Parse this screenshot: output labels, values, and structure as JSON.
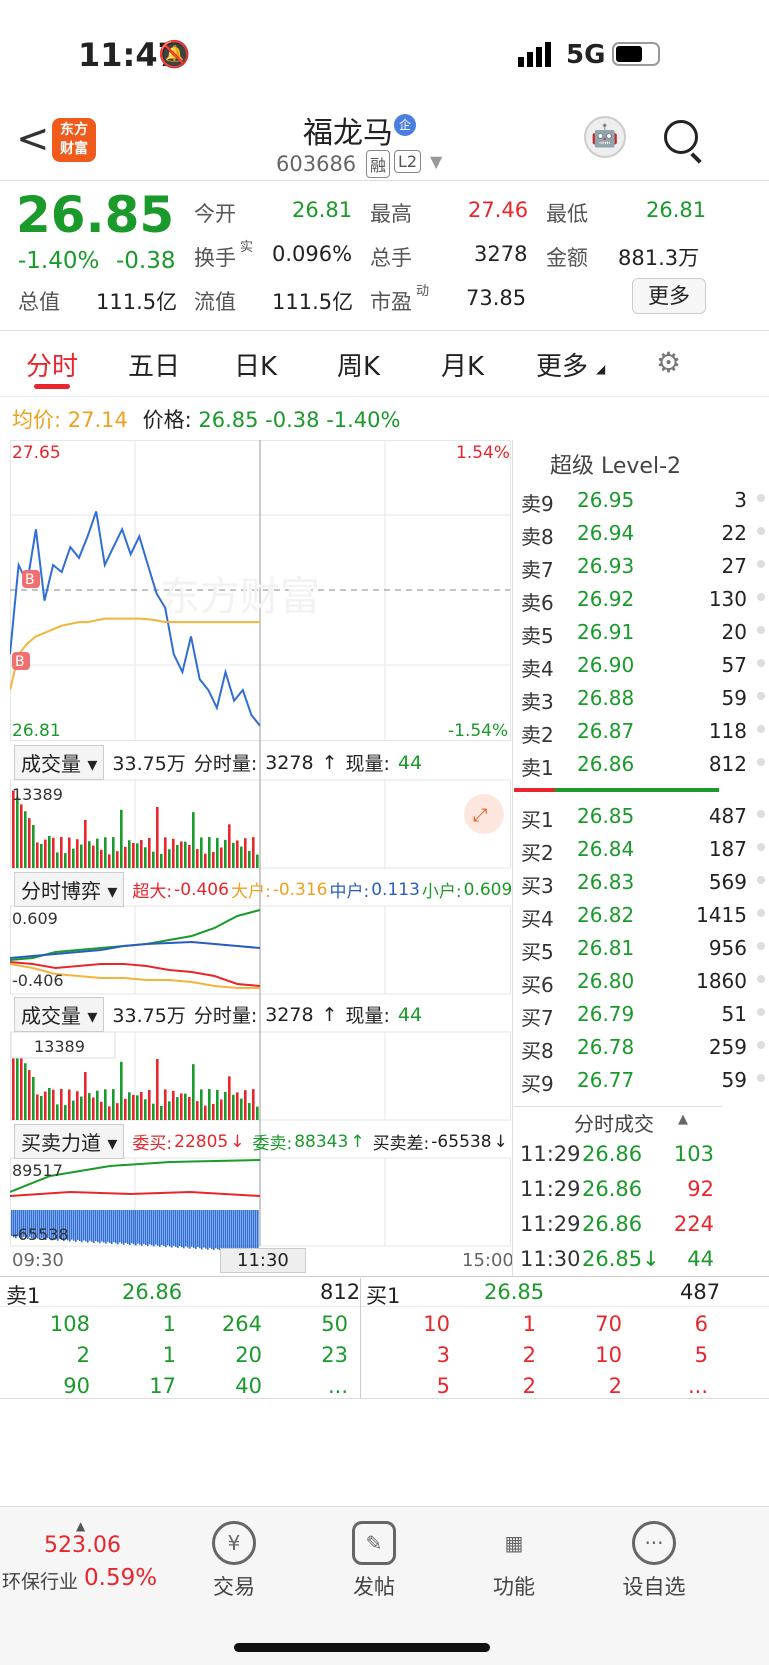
{
  "status": {
    "time": "11:47",
    "network": "5G"
  },
  "header": {
    "back": "<",
    "logo_l1": "东方",
    "logo_l2": "财富",
    "title": "福龙马",
    "title_badge": "企",
    "code": "603686",
    "tag1": "融",
    "tag2": "L2"
  },
  "quote": {
    "price": "26.85",
    "pct": "-1.40%",
    "chg": "-0.38",
    "open_l": "今开",
    "open": "26.81",
    "high_l": "最高",
    "high": "27.46",
    "low_l": "最低",
    "low": "26.81",
    "turn_l": "换手",
    "turn_sup": "实",
    "turn": "0.096%",
    "vol_l": "总手",
    "vol": "3278",
    "amt_l": "金额",
    "amt": "881.3万",
    "cap_l": "总值",
    "cap": "111.5亿",
    "float_l": "流值",
    "float": "111.5亿",
    "pe_l": "市盈",
    "pe_sup": "动",
    "pe": "73.85",
    "more": "更多"
  },
  "tabs": [
    "分时",
    "五日",
    "日K",
    "周K",
    "月K",
    "更多"
  ],
  "priceline": {
    "avg_l": "均价:",
    "avg": "27.14",
    "price_l": "价格:",
    "price": "26.85",
    "chg": "-0.38",
    "pct": "-1.40%"
  },
  "chart": {
    "ymax": "27.65",
    "ymin": "26.81",
    "pmax": "1.54%",
    "pmin": "-1.54%",
    "watermark": "东方财富",
    "t_start": "09:30",
    "t_mid": "11:30",
    "t_end": "15:00"
  },
  "chart_data": {
    "type": "line",
    "series": [
      {
        "name": "价格",
        "values": [
          27.05,
          27.3,
          27.25,
          27.4,
          27.2,
          27.3,
          27.28,
          27.35,
          27.32,
          27.38,
          27.45,
          27.3,
          27.35,
          27.4,
          27.33,
          27.38,
          27.3,
          27.22,
          27.18,
          27.05,
          27.0,
          27.1,
          26.98,
          26.95,
          26.9,
          27.0,
          26.92,
          26.95,
          26.88,
          26.85
        ]
      },
      {
        "name": "均价",
        "values": [
          26.95,
          27.05,
          27.08,
          27.1,
          27.11,
          27.12,
          27.13,
          27.135,
          27.14,
          27.14,
          27.145,
          27.15,
          27.15,
          27.15,
          27.15,
          27.15,
          27.148,
          27.145,
          27.14,
          27.14,
          27.14,
          27.14,
          27.14,
          27.14,
          27.14,
          27.14,
          27.14,
          27.14,
          27.14,
          27.14
        ]
      }
    ],
    "ylim": [
      26.81,
      27.65
    ]
  },
  "vol1": {
    "label": "成交量",
    "total": "33.75万",
    "fs_l": "分时量:",
    "fs": "3278",
    "now_l": "现量:",
    "now": "44",
    "max": "13389"
  },
  "game": {
    "label": "分时博弈",
    "big_l": "超大:",
    "big": "-0.406",
    "large_l": "大户:",
    "large": "-0.316",
    "mid_l": "中户:",
    "mid": "0.113",
    "small_l": "小户:",
    "small": "0.609",
    "ymax": "0.609",
    "ymin": "-0.406"
  },
  "vol2": {
    "label": "成交量",
    "total": "33.75万",
    "fs_l": "分时量:",
    "fs": "3278",
    "now_l": "现量:",
    "now": "44",
    "max": "13389"
  },
  "force": {
    "label": "买卖力道",
    "buy_l": "委买:",
    "buy": "22805",
    "sell_l": "委卖:",
    "sell": "88343",
    "diff_l": "买卖差:",
    "diff": "-65538",
    "ymax": "89517",
    "ymin": "-65538"
  },
  "level2": {
    "title": "超级 Level-2",
    "asks": [
      [
        "卖9",
        "26.95",
        "3"
      ],
      [
        "卖8",
        "26.94",
        "22"
      ],
      [
        "卖7",
        "26.93",
        "27"
      ],
      [
        "卖6",
        "26.92",
        "130"
      ],
      [
        "卖5",
        "26.91",
        "20"
      ],
      [
        "卖4",
        "26.90",
        "57"
      ],
      [
        "卖3",
        "26.88",
        "59"
      ],
      [
        "卖2",
        "26.87",
        "118"
      ],
      [
        "卖1",
        "26.86",
        "812"
      ]
    ],
    "bids": [
      [
        "买1",
        "26.85",
        "487"
      ],
      [
        "买2",
        "26.84",
        "187"
      ],
      [
        "买3",
        "26.83",
        "569"
      ],
      [
        "买4",
        "26.82",
        "1415"
      ],
      [
        "买5",
        "26.81",
        "956"
      ],
      [
        "买6",
        "26.80",
        "1860"
      ],
      [
        "买7",
        "26.79",
        "51"
      ],
      [
        "买8",
        "26.78",
        "259"
      ],
      [
        "买9",
        "26.77",
        "59"
      ]
    ],
    "ticks_title": "分时成交",
    "ticks": [
      [
        "11:29",
        "26.86",
        "103"
      ],
      [
        "11:29",
        "26.86",
        "92"
      ],
      [
        "11:29",
        "26.86",
        "224"
      ],
      [
        "11:30",
        "26.85↓",
        "44"
      ]
    ]
  },
  "queue": {
    "sell_l": "卖1",
    "sell_p": "26.86",
    "sell_v": "812",
    "buy_l": "买1",
    "buy_p": "26.85",
    "buy_v": "487",
    "sell_rows": [
      [
        "108",
        "1",
        "264",
        "50"
      ],
      [
        "2",
        "1",
        "20",
        "23"
      ],
      [
        "90",
        "17",
        "40",
        "..."
      ]
    ],
    "buy_rows": [
      [
        "10",
        "1",
        "70",
        "6"
      ],
      [
        "3",
        "2",
        "10",
        "5"
      ],
      [
        "5",
        "2",
        "2",
        "..."
      ]
    ]
  },
  "bottom": {
    "index": "523.06",
    "sector": "环保行业",
    "sector_pct": "0.59%",
    "trade": "交易",
    "post": "发帖",
    "func": "功能",
    "fav": "设自选"
  }
}
